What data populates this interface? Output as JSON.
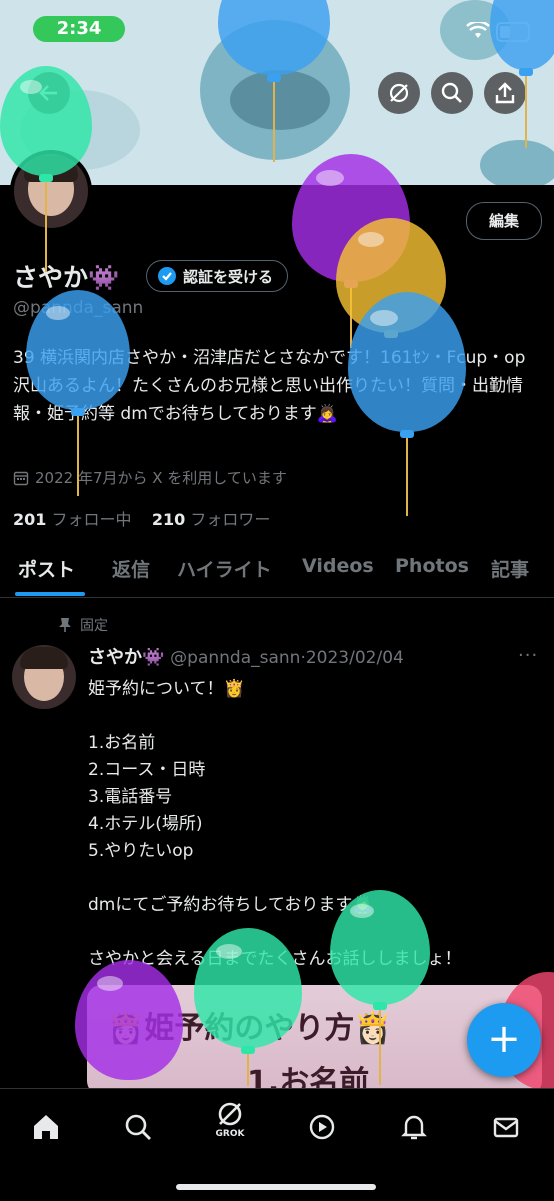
{
  "status_bar": {
    "time": "2:34",
    "icons": [
      "wifi-icon",
      "battery-icon"
    ]
  },
  "header_actions": {
    "back": "back-arrow-icon",
    "grok": "grok-icon",
    "search": "search-icon",
    "share": "share-icon"
  },
  "profile": {
    "edit_label": "編集",
    "display_name": "さやか👾",
    "verify_label": "認証を受ける",
    "handle": "@pannda_sann",
    "bio": "39 横浜関内店さやか・沼津店だとさなかです！161ｾﾝ・Fcup・op沢山あるよん！たくさんのお兄様と思い出作りたい！質問・出勤情報・姫予約等 dmでお待ちしております🙇‍♀️",
    "joined": "2022 年7月から X を利用しています",
    "following_count": "201",
    "following_label": "フォロー中",
    "followers_count": "210",
    "followers_label": "フォロワー"
  },
  "tabs": [
    "ポスト",
    "返信",
    "ハイライト",
    "Videos",
    "Photos",
    "記事"
  ],
  "post": {
    "pinned_label": "固定",
    "author_name": "さやか👾",
    "author_handle": "@pannda_sann",
    "separator": "·",
    "date": "2023/02/04",
    "more": "···",
    "body": "姫予約について！👸\n\n1.お名前\n2.コース・日時\n3.電話番号\n4.ホテル(場所)\n5.やりたいop\n\ndmにてご予約お待ちしております🙇‍♀️\n\nさやかと会える日までたくさんお話ししましょ！",
    "image_title": "👸🏻姫予約のやり方👸🏻",
    "image_subtitle": "1.お名前"
  },
  "fab_label": "+",
  "bottom_nav": {
    "grok_label": "GROK"
  },
  "colors": {
    "accent": "#1d9bf0",
    "background": "#000000",
    "time_pill": "#34c759"
  }
}
